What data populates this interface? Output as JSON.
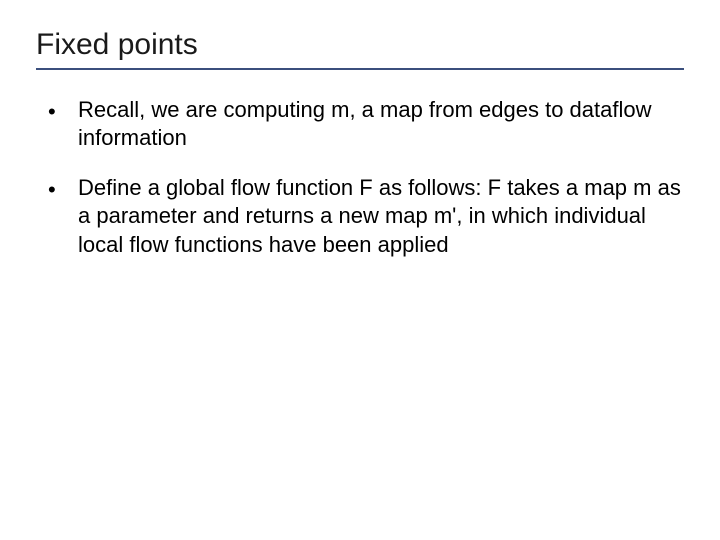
{
  "slide": {
    "title": "Fixed points",
    "bullets": [
      {
        "marker": "•",
        "text": "Recall, we are computing m, a map from edges to dataflow information"
      },
      {
        "marker": "•",
        "text": "Define a global flow function F as follows: F takes a map m as a parameter and returns a new map m', in which individual local flow functions have been applied"
      }
    ]
  }
}
